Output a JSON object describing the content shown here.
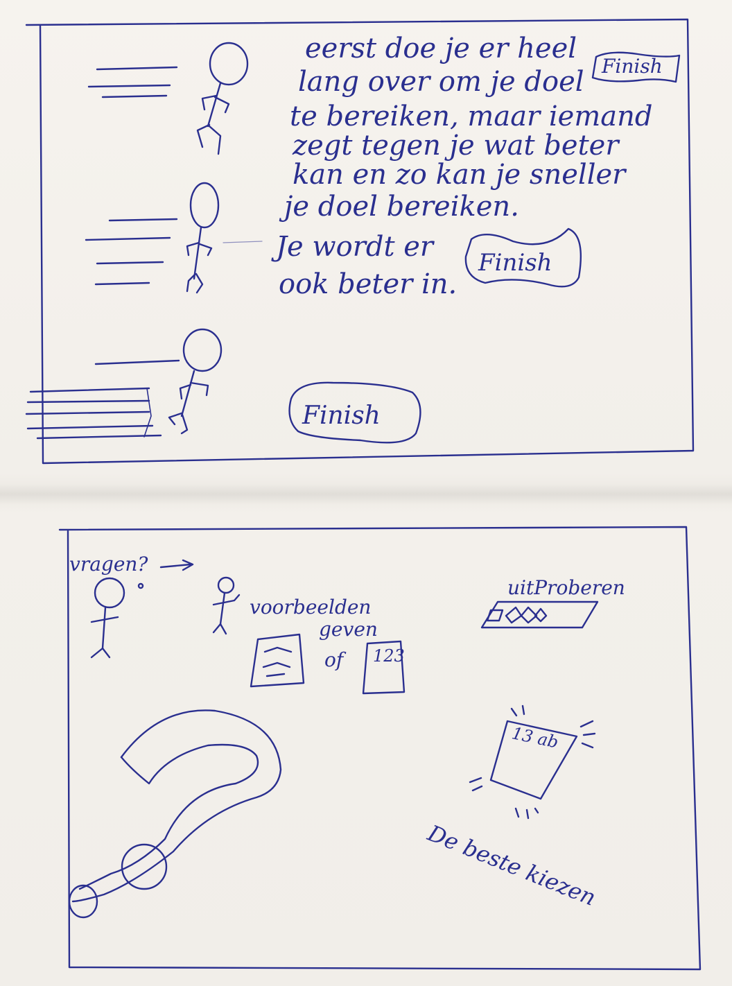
{
  "top_panel": {
    "story_lines": [
      "eerst doe je er heel",
      "lang over om je doel",
      "te bereiken, maar iemand",
      "zegt tegen je wat beter",
      "kan en zo kan je sneller",
      "je doel bereiken."
    ],
    "better_lines": [
      "Je wordt er",
      "ook beter in."
    ],
    "finish_labels": [
      "Finish",
      "Finish",
      "Finish"
    ]
  },
  "bottom_panel": {
    "vragen": "vragen?",
    "voorbeelden_line1": "voorbeelden",
    "voorbeelden_line2": "geven",
    "of": "of",
    "card_number": "123",
    "uitproberen": "uitProberen",
    "grade": "13 ab",
    "beste_kiezen": "De beste kiezen"
  },
  "colors": {
    "ink": "#2a2f8f",
    "paper": "#f4f1ec"
  }
}
